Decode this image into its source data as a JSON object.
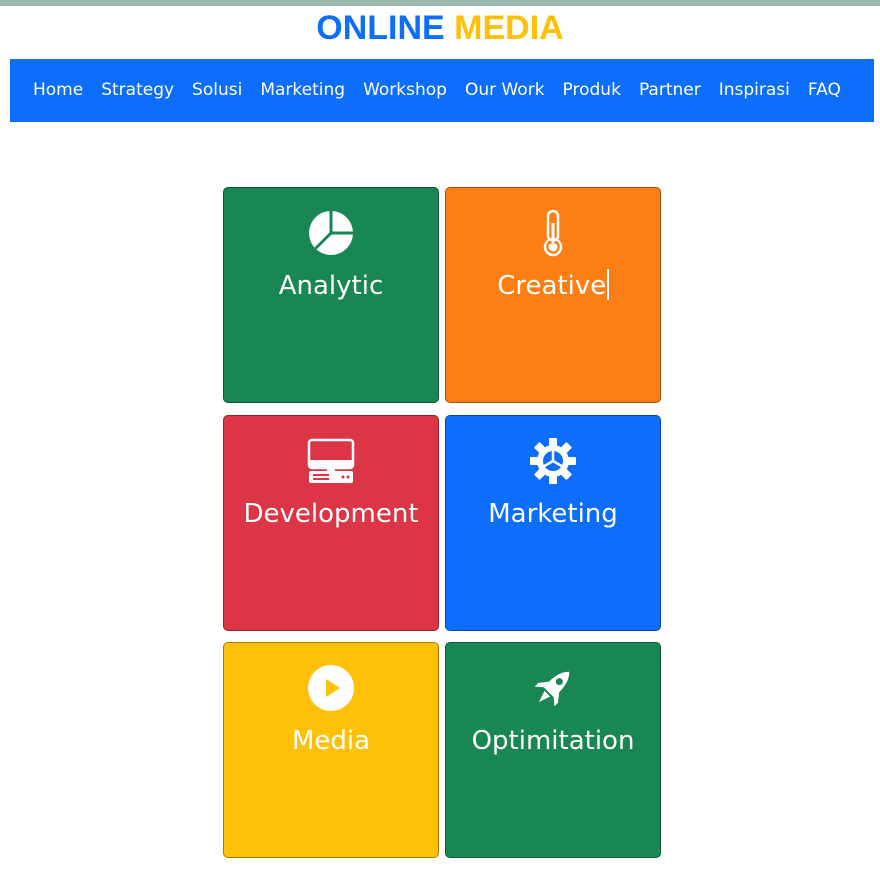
{
  "brand": {
    "word1": "ONLINE",
    "word2": "MEDIA"
  },
  "nav": {
    "items": [
      "Home",
      "Strategy",
      "Solusi",
      "Marketing",
      "Workshop",
      "Our Work",
      "Produk",
      "Partner",
      "Inspirasi",
      "FAQ"
    ]
  },
  "tiles": [
    {
      "label": "Analytic",
      "icon": "pie-chart-icon",
      "color": "#198754"
    },
    {
      "label": "Creative",
      "icon": "thermometer-icon",
      "color": "#fd7e14"
    },
    {
      "label": "Development",
      "icon": "desktop-computer-icon",
      "color": "#dc3545"
    },
    {
      "label": "Marketing",
      "icon": "gear-icon",
      "color": "#0d6efd"
    },
    {
      "label": "Media",
      "icon": "play-circle-icon",
      "color": "#ffc107"
    },
    {
      "label": "Optimitation",
      "icon": "rocket-icon",
      "color": "#198754"
    }
  ],
  "colors": {
    "primary": "#0d6efd",
    "warning": "#ffc107",
    "success": "#198754",
    "danger": "#dc3545",
    "orange": "#fd7e14"
  }
}
